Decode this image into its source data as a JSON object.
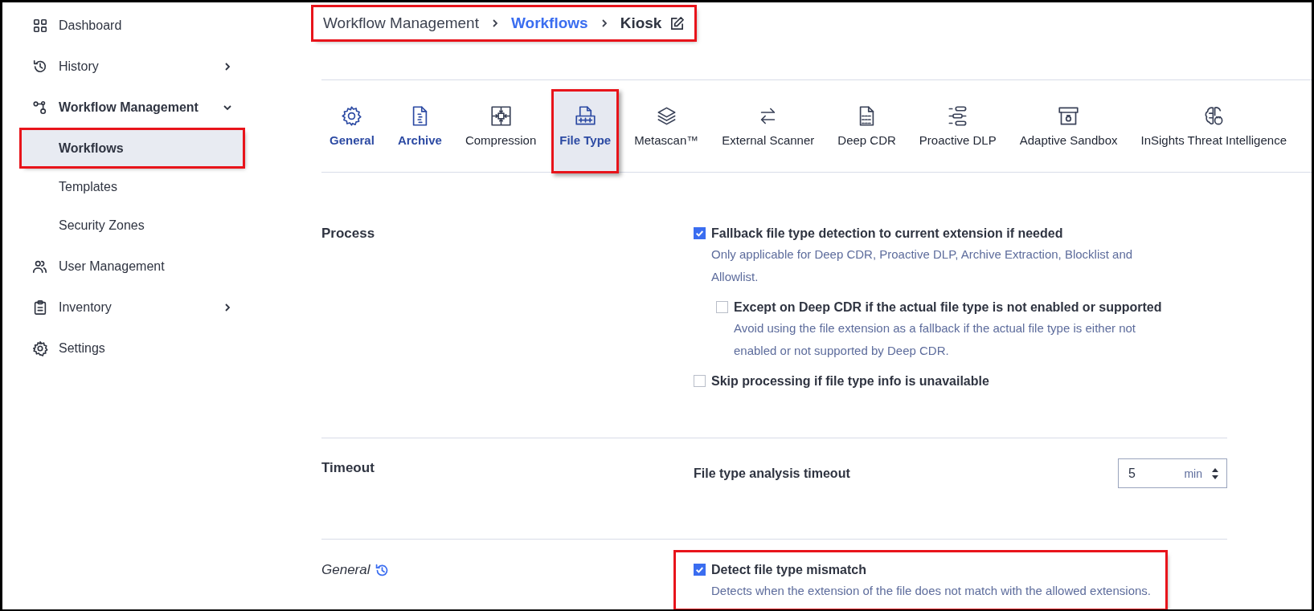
{
  "sidebar": {
    "items": [
      {
        "label": "Dashboard",
        "selected": false
      },
      {
        "label": "History",
        "selected": false,
        "expanded": false
      },
      {
        "label": "Workflow Management",
        "selected": false,
        "expanded": true,
        "children": [
          {
            "label": "Workflows",
            "selected": true,
            "annotated": true
          },
          {
            "label": "Templates",
            "selected": false,
            "annotated": false
          },
          {
            "label": "Security Zones",
            "selected": false,
            "annotated": false
          }
        ]
      },
      {
        "label": "User Management",
        "selected": false
      },
      {
        "label": "Inventory",
        "selected": false,
        "expanded": false
      },
      {
        "label": "Settings",
        "selected": false
      }
    ]
  },
  "breadcrumb": {
    "annotated": true,
    "items": [
      {
        "label": "Workflow Management",
        "kind": "parent"
      },
      {
        "label": "Workflows",
        "kind": "link"
      },
      {
        "label": "Kiosk",
        "kind": "current"
      }
    ]
  },
  "tabs": [
    {
      "label": "General",
      "selected": false,
      "modified": true,
      "annotated": false
    },
    {
      "label": "Archive",
      "selected": false,
      "modified": true,
      "annotated": false
    },
    {
      "label": "Compression",
      "selected": false,
      "modified": false,
      "annotated": false
    },
    {
      "label": "File Type",
      "selected": true,
      "modified": true,
      "annotated": true
    },
    {
      "label": "Metascan™",
      "selected": false,
      "modified": false,
      "annotated": false
    },
    {
      "label": "External Scanner",
      "selected": false,
      "modified": false,
      "annotated": false
    },
    {
      "label": "Deep CDR",
      "selected": false,
      "modified": false,
      "annotated": false
    },
    {
      "label": "Proactive DLP",
      "selected": false,
      "modified": false,
      "annotated": false
    },
    {
      "label": "Adaptive Sandbox",
      "selected": false,
      "modified": false,
      "annotated": false
    },
    {
      "label": "InSights Threat Intelligence",
      "selected": false,
      "modified": false,
      "annotated": false
    }
  ],
  "sections": [
    {
      "kind": "options",
      "title": "Process",
      "italic": false,
      "options": [
        {
          "label": "Fallback file type detection to current extension if needed",
          "checked": true,
          "annotated": false,
          "description": "Only applicable for Deep CDR, Proactive DLP, Archive Extraction, Blocklist and Allowlist.",
          "children": [
            {
              "label": "Except on Deep CDR if the actual file type is not enabled or supported",
              "checked": false,
              "annotated": false,
              "description": "Avoid using the file extension as a fallback if the actual file type is either not enabled or not supported by Deep CDR."
            }
          ]
        },
        {
          "label": "Skip processing if file type info is unavailable",
          "checked": false,
          "annotated": false
        }
      ]
    },
    {
      "kind": "number",
      "title": "Timeout",
      "italic": false,
      "field": {
        "label": "File type analysis timeout",
        "value": "5",
        "unit": "min"
      }
    },
    {
      "kind": "options",
      "title": "General",
      "italic": true,
      "history": true,
      "options": [
        {
          "label": "Detect file type mismatch",
          "checked": true,
          "annotated": true,
          "description": "Detects when the extension of the file does not match with the allowed extensions."
        }
      ]
    }
  ]
}
